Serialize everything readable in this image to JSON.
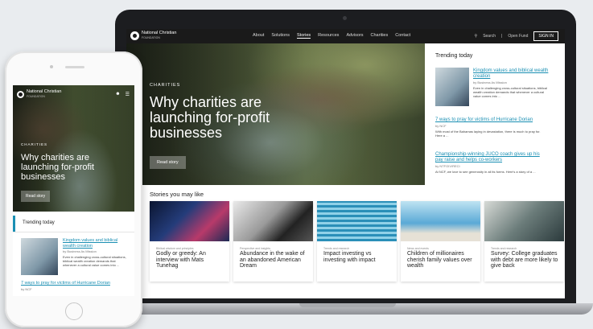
{
  "site": {
    "logo_name": "National Christian",
    "logo_sub": "FOUNDATION"
  },
  "nav": {
    "items": [
      "About",
      "Solutions",
      "Stories",
      "Resources",
      "Advisors",
      "Charities",
      "Contact"
    ],
    "search_label": "Search",
    "open_fund_label": "Open Fund",
    "signin_label": "SIGN IN"
  },
  "hero": {
    "tag": "CHARITIES",
    "title": "Why charities are launching for-profit businesses",
    "button_label": "Read story"
  },
  "trending": {
    "heading": "Trending today",
    "items": [
      {
        "title": "Kingdom values and biblical wealth creation",
        "author": "by Business As Mission",
        "excerpt": "Even in challenging cross-cultural situations, biblical wealth creation demands that whenever a cultural value comes into ..."
      },
      {
        "title": "7 ways to pray for victims of Hurricane Dorian",
        "author": "by NCF",
        "excerpt": "With most of the Bahamas laying in devastation, there is much to pray for. Here a ..."
      },
      {
        "title": "Championship-winning JUCO coach gives up his pay raise and helps co-workers",
        "author": "by NTFGIV/RECI",
        "excerpt": "At NCF, we love to see generosity in all its forms. Here's a story of a ..."
      }
    ]
  },
  "stories": {
    "heading": "Stories you may like",
    "cards": [
      {
        "category": "Biblical wisdom and principles",
        "title": "Godly or greedy: An interview with Mats Tunehag"
      },
      {
        "category": "Perspective and insights",
        "title": "Abundance in the wake of an abandoned American Dream"
      },
      {
        "category": "Trends and research",
        "title": "Impact investing vs investing with impact"
      },
      {
        "category": "News and events",
        "title": "Children of millionaires cherish family values over wealth"
      },
      {
        "category": "Trends and research",
        "title": "Survey: College graduates with debt are more likely to give back"
      }
    ]
  },
  "phone": {
    "hero_tag": "CHARITIES",
    "hero_title": "Why charities are launching for-profit businesses",
    "button_label": "Read story",
    "trending_heading": "Trending today",
    "item1_title": "Kingdom values and biblical wealth creation",
    "item1_author": "by Business As Mission",
    "item1_excerpt": "Even in challenging cross-cultural situations, biblical wealth creation demands that whenever a cultural value comes into ...",
    "item2_title": "7 ways to pray for victims of Hurricane Dorian",
    "item2_author": "by NCF"
  },
  "colors": {
    "accent": "#1a8fb3",
    "nav_bg": "#1a1a1a"
  }
}
